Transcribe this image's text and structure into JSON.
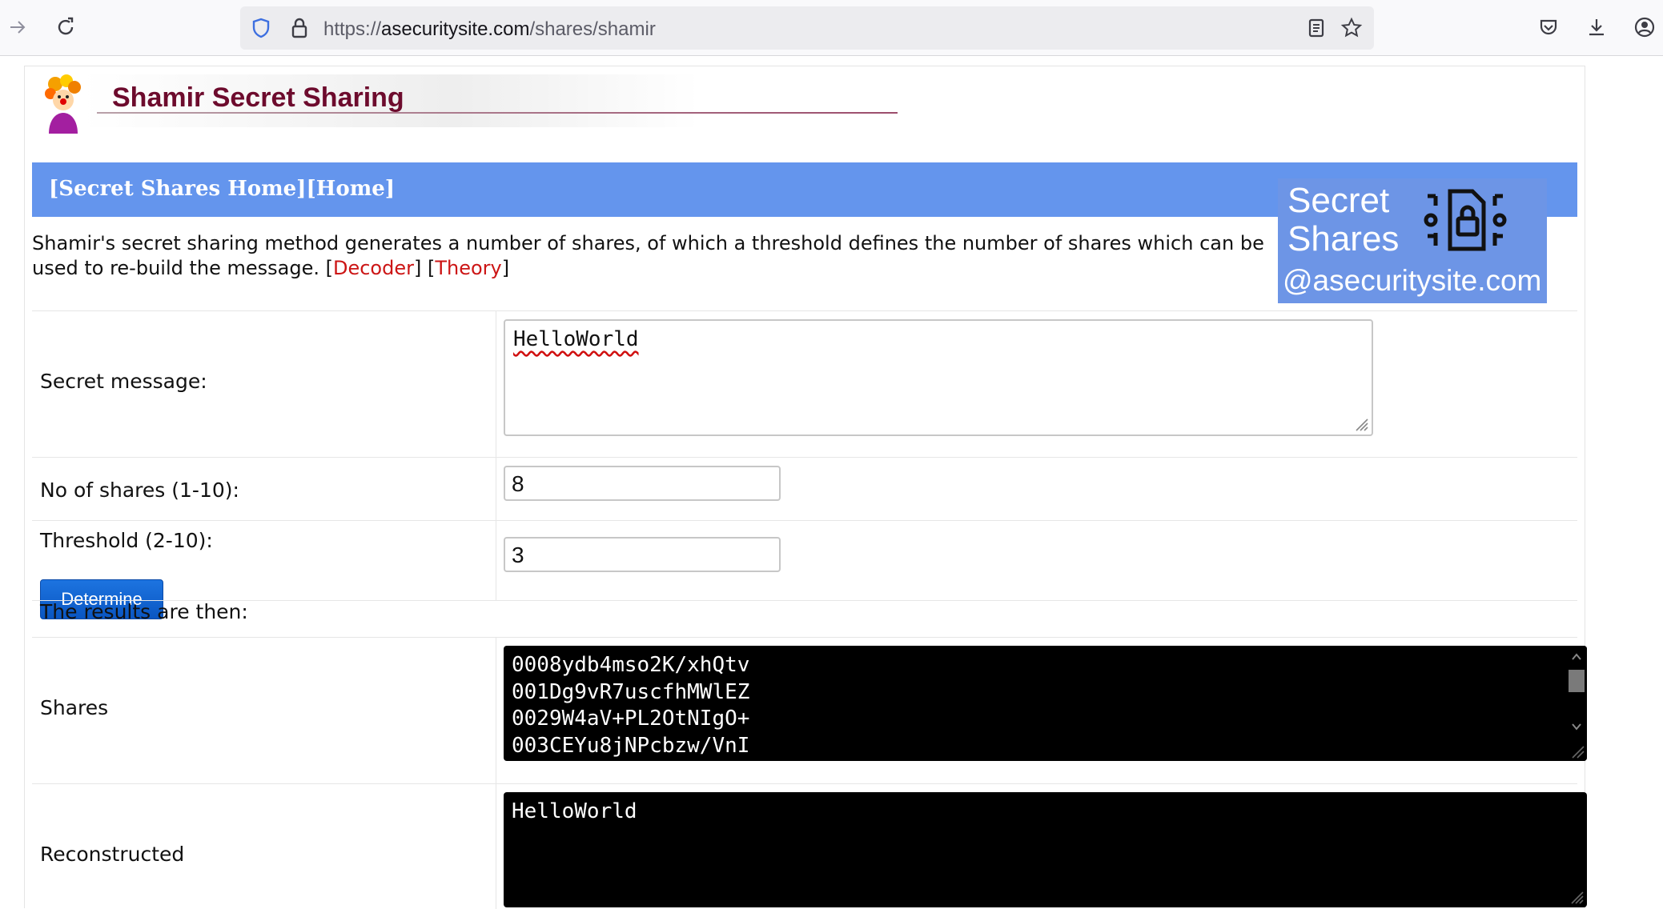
{
  "browser": {
    "url_prefix": "https://",
    "url_domain": "asecuritysite.com",
    "url_path": "/shares/shamir"
  },
  "page": {
    "title": "Shamir Secret Sharing",
    "nav": {
      "secret_shares_home": "[Secret Shares Home]",
      "home": "[Home]"
    },
    "badge": {
      "line1": "Secret",
      "line2": "Shares",
      "line3": "@asecuritysite.com"
    },
    "intro": {
      "text": "Shamir's secret sharing method generates a number of shares, of which a threshold defines the number of shares which can be used to re-build the message.",
      "decoder_link": "Decoder",
      "theory_link": "Theory"
    }
  },
  "form": {
    "secret_label": "Secret message:",
    "secret_value": "HelloWorld",
    "shares_label": "No of shares (1-10):",
    "shares_value": "8",
    "threshold_label": "Threshold (2-10):",
    "threshold_value": "3",
    "determine_button": "Determine",
    "results_intro": "The results are then:",
    "shares_output_label": "Shares",
    "shares_output": [
      "0008ydb4mso2K/xhQtv",
      "001Dg9vR7uscfhMWlEZ",
      "0029W4aV+PL2OtNIgO+",
      "003CEYu8jNPcbzw/VnI"
    ],
    "reconstructed_label": "Reconstructed",
    "reconstructed_value": "HelloWorld"
  },
  "colors": {
    "nav_bar": "#6495ed",
    "title": "#6d0b2d",
    "link": "#cc1515",
    "button": "#0a56c2"
  }
}
